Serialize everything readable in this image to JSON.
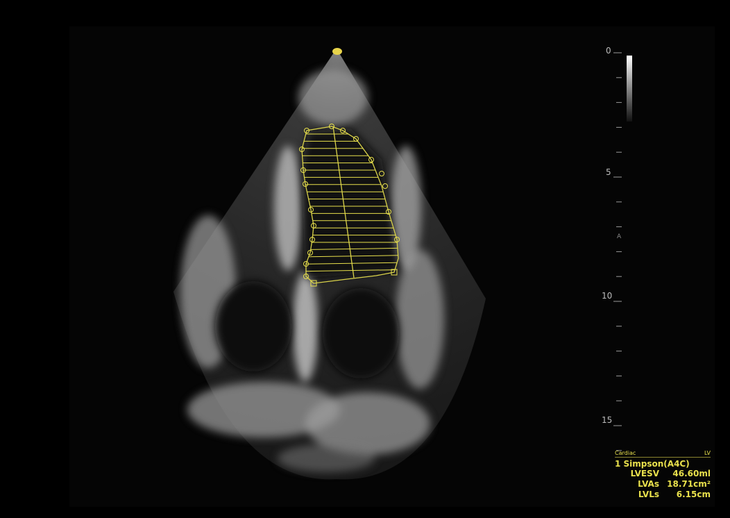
{
  "depth_scale": {
    "labels": [
      "0",
      "5",
      "10",
      "15"
    ],
    "unit_marker": "A"
  },
  "overlay": {
    "color": "#e8e04c",
    "trace_type": "simpson-disc-tracing"
  },
  "measurement_panel": {
    "preset": "Cardiac",
    "target": "LV",
    "method": "1 Simpson(A4C)",
    "rows": [
      {
        "label": "LVESV",
        "value": "46.60ml"
      },
      {
        "label": "LVAs",
        "value": "18.71cm²"
      },
      {
        "label": "LVLs",
        "value": "6.15cm"
      }
    ]
  }
}
